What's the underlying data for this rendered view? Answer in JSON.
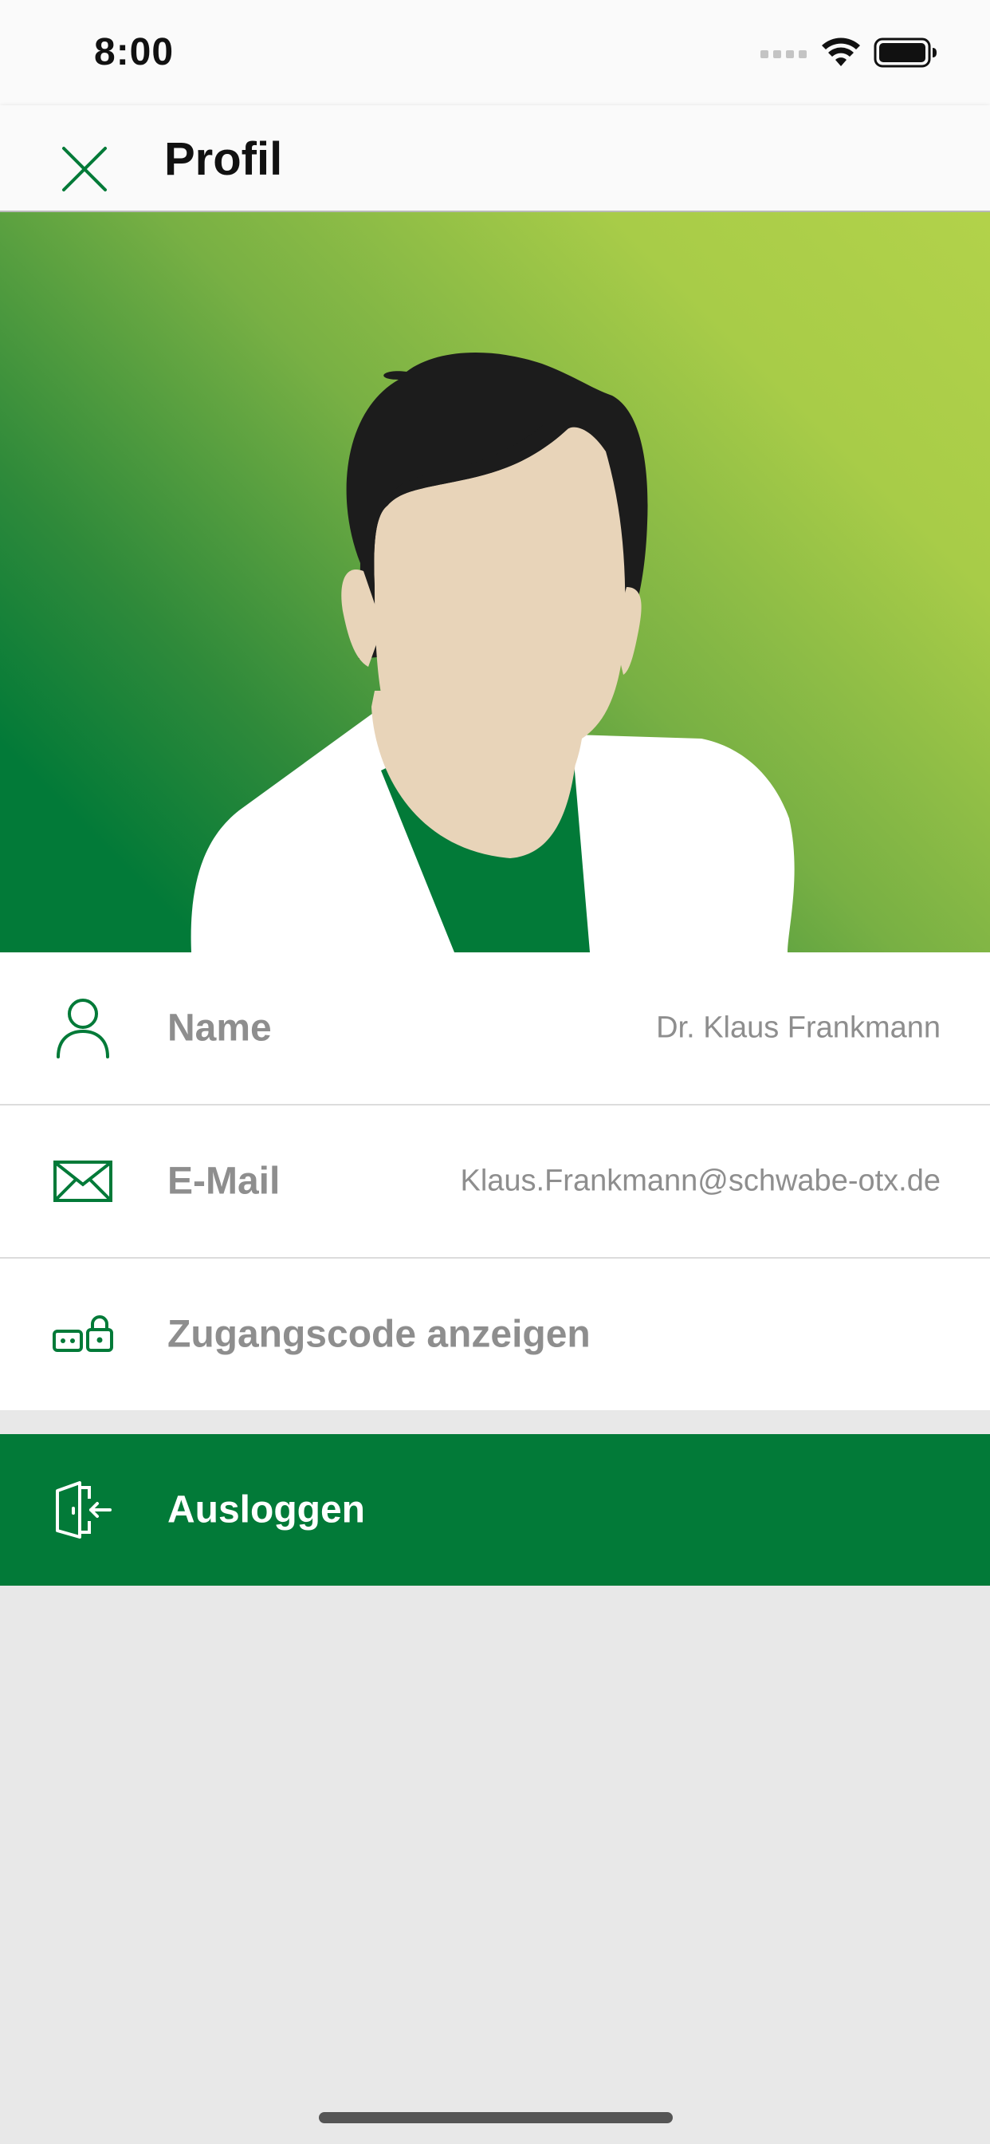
{
  "status_bar": {
    "time": "8:00"
  },
  "header": {
    "title": "Profil"
  },
  "profile": {
    "rows": [
      {
        "label": "Name",
        "value": "Dr. Klaus Frankmann",
        "icon": "person-icon"
      },
      {
        "label": "E-Mail",
        "value": "Klaus.Frankmann@schwabe-otx.de",
        "icon": "mail-icon"
      },
      {
        "label": "Zugangscode anzeigen",
        "icon": "access-code-lock-icon"
      }
    ]
  },
  "logout": {
    "label": "Ausloggen",
    "icon": "logout-door-icon"
  },
  "colors": {
    "accent": "#027A38",
    "gradient_light": "#B2D24A",
    "label_gray": "#8E8E8E",
    "background": "#E8E8E8"
  }
}
